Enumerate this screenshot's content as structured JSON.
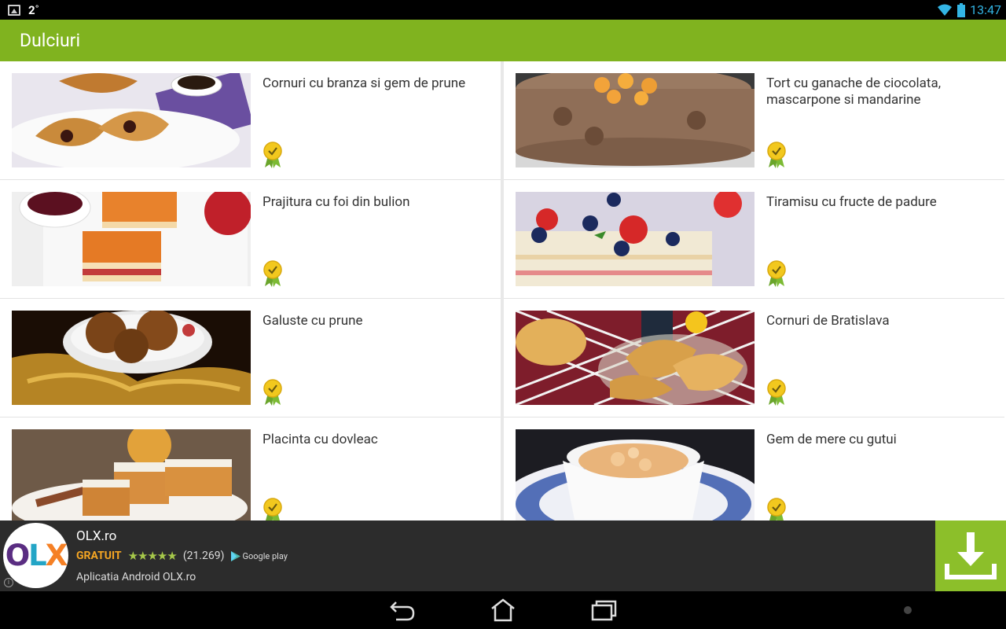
{
  "status_bar": {
    "notification_count": "2˚",
    "time": "13:47"
  },
  "app_bar": {
    "title": "Dulciuri"
  },
  "recipes": [
    {
      "title": "Cornuri cu branza si gem de prune"
    },
    {
      "title": "Tort cu ganache de ciocolata, mascarpone si mandarine"
    },
    {
      "title": "Prajitura cu foi din bulion"
    },
    {
      "title": "Tiramisu cu fructe de padure"
    },
    {
      "title": "Galuste cu prune"
    },
    {
      "title": "Cornuri de Bratislava"
    },
    {
      "title": "Placinta cu dovleac"
    },
    {
      "title": "Gem de mere cu gutui"
    }
  ],
  "ad": {
    "app_name": "OLX.ro",
    "price": "GRATUIT",
    "rating_count": "(21.269)",
    "store": "Google play",
    "description": "Aplicatia Android OLX.ro",
    "logo_letters": [
      "O",
      "L",
      "X"
    ]
  },
  "colors": {
    "app_bar": "#80b31f",
    "download": "#8cbf2a",
    "price": "#f5a623",
    "status_accent": "#33b5e5"
  }
}
